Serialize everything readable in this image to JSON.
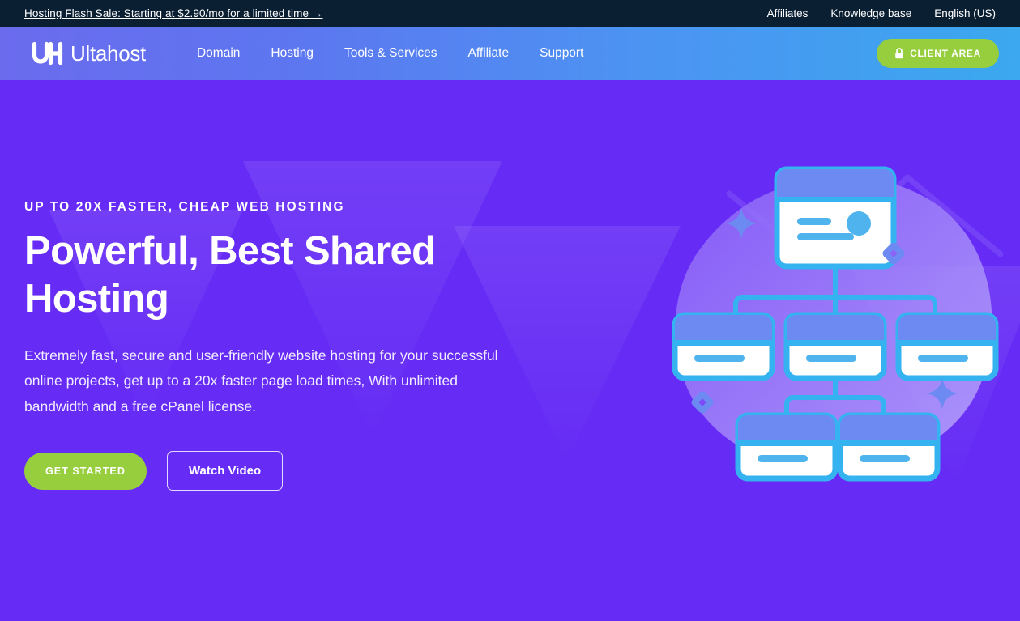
{
  "topbar": {
    "promo": "Hosting Flash Sale: Starting at $2.90/mo for a limited time →",
    "links": [
      {
        "label": "Affiliates",
        "name": "affiliates"
      },
      {
        "label": "Knowledge base",
        "name": "knowledge-base"
      },
      {
        "label": "English (US)",
        "name": "language-selector"
      }
    ]
  },
  "header": {
    "logo_text": "Ultahost",
    "logo_mark": "uh-monogram-icon",
    "nav": [
      {
        "label": "Domain",
        "name": "domain"
      },
      {
        "label": "Hosting",
        "name": "hosting"
      },
      {
        "label": "Tools & Services",
        "name": "tools-services"
      },
      {
        "label": "Affiliate",
        "name": "affiliate"
      },
      {
        "label": "Support",
        "name": "support"
      }
    ],
    "client_area_label": "CLIENT AREA",
    "client_area_icon": "lock-icon"
  },
  "hero": {
    "eyebrow": "Up to 20x Faster, Cheap Web Hosting",
    "title": "Powerful, Best Shared Hosting",
    "subtitle": "Extremely fast, secure and user-friendly website hosting for your successful online projects, get up to a 20x faster page load times, With unlimited bandwidth and a free cPanel license.",
    "primary_cta": "GET STARTED",
    "secondary_cta": "Watch Video",
    "illustration": "site-network-hierarchy-illustration"
  },
  "colors": {
    "topbar_bg": "#0B1F33",
    "header_gradient_start": "#6B6BEE",
    "header_gradient_end": "#3BA8EF",
    "hero_bg": "#662CF5",
    "accent_green": "#97CE3E",
    "illustration_blue": "#35B2F0",
    "illustration_indigo": "#6C8AF2",
    "text_white": "#FFFFFF"
  }
}
